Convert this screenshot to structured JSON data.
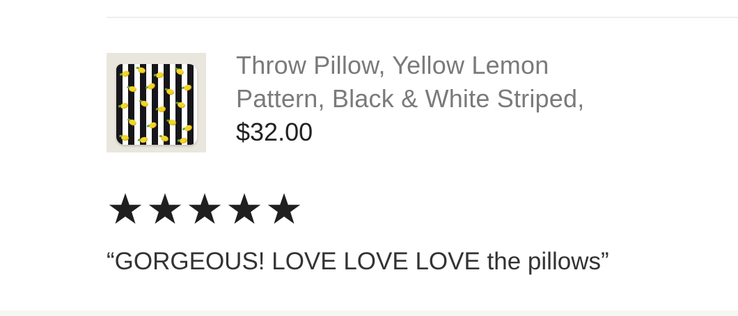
{
  "review": {
    "product": {
      "title_line_1": "Throw Pillow, Yellow Lemon",
      "title_line_2": "Pattern, Black & White Striped,",
      "price": "$32.00",
      "image": {
        "alt": "yellow lemon pattern black and white striped throw pillow"
      }
    },
    "rating": {
      "value": 5,
      "max": 5,
      "icon": "star-icon",
      "color": "#1f1f1f"
    },
    "quote": "“GORGEOUS! LOVE LOVE LOVE the pillows”"
  },
  "colors": {
    "title": "#7a7a7a",
    "price": "#222222",
    "body_text": "#333333",
    "divider": "#efefef",
    "pillow_stripe_dark": "#16161a",
    "pillow_stripe_light": "#ffffff",
    "lemon": "#f3d52a"
  }
}
